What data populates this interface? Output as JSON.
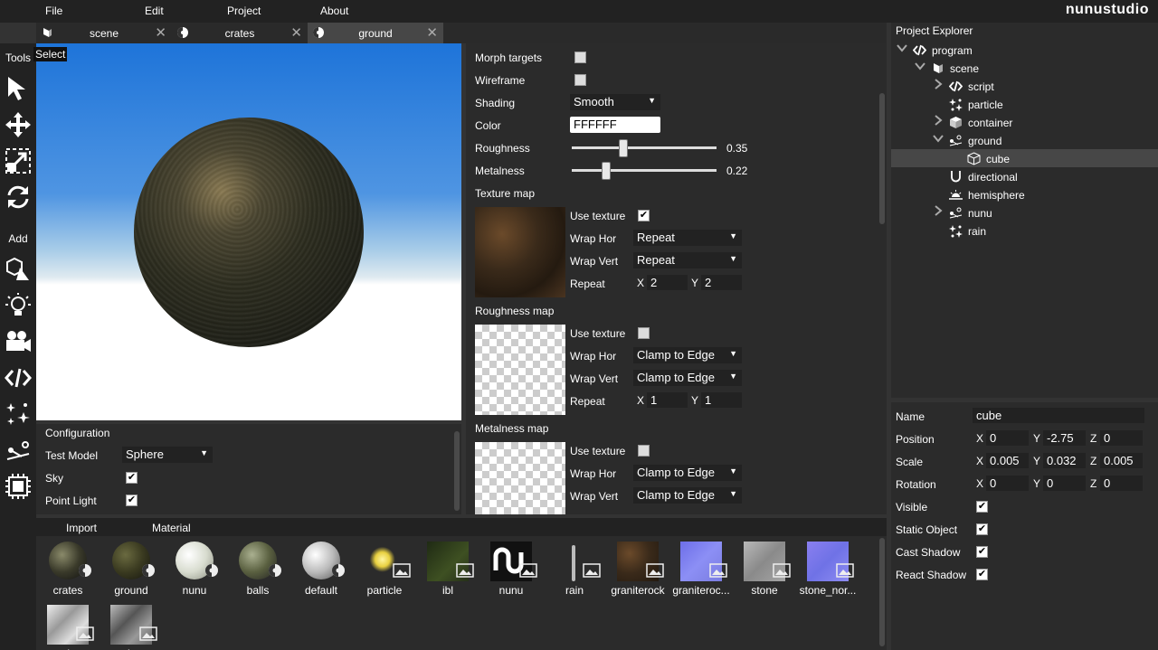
{
  "menu": {
    "file": "File",
    "edit": "Edit",
    "project": "Project",
    "about": "About"
  },
  "logo": "nunustudio",
  "tabs": [
    {
      "label": "scene",
      "icon": "scene-icon"
    },
    {
      "label": "crates",
      "icon": "material-icon"
    },
    {
      "label": "ground",
      "icon": "material-icon",
      "active": true
    }
  ],
  "toolbar": {
    "tools_heading": "Tools",
    "add_heading": "Add",
    "select_tooltip": "Select"
  },
  "config": {
    "title": "Configuration",
    "test_model_label": "Test Model",
    "test_model_value": "Sphere",
    "sky_label": "Sky",
    "sky_checked": true,
    "point_light_label": "Point Light",
    "point_light_checked": true
  },
  "material": {
    "morph_targets_label": "Morph targets",
    "wireframe_label": "Wireframe",
    "shading_label": "Shading",
    "shading_value": "Smooth",
    "color_label": "Color",
    "color_value": "FFFFFF",
    "roughness_label": "Roughness",
    "roughness_value": "0.35",
    "metalness_label": "Metalness",
    "metalness_value": "0.22",
    "texture_map": {
      "title": "Texture map",
      "use_texture_label": "Use texture",
      "use_texture": true,
      "wrap_hor_label": "Wrap Hor",
      "wrap_hor": "Repeat",
      "wrap_vert_label": "Wrap Vert",
      "wrap_vert": "Repeat",
      "repeat_label": "Repeat",
      "x_label": "X",
      "x": "2",
      "y_label": "Y",
      "y": "2"
    },
    "roughness_map": {
      "title": "Roughness map",
      "use_texture_label": "Use texture",
      "use_texture": false,
      "wrap_hor_label": "Wrap Hor",
      "wrap_hor": "Clamp to Edge",
      "wrap_vert_label": "Wrap Vert",
      "wrap_vert": "Clamp to Edge",
      "repeat_label": "Repeat",
      "x_label": "X",
      "x": "1",
      "y_label": "Y",
      "y": "1"
    },
    "metalness_map": {
      "title": "Metalness map",
      "use_texture_label": "Use texture",
      "use_texture": false,
      "wrap_hor_label": "Wrap Hor",
      "wrap_hor": "Clamp to Edge",
      "wrap_vert_label": "Wrap Vert",
      "wrap_vert": "Clamp to Edge"
    }
  },
  "explorer": {
    "title": "Project Explorer",
    "items": [
      {
        "label": "program",
        "icon": "code-icon"
      },
      {
        "label": "scene",
        "icon": "scene-icon"
      },
      {
        "label": "script",
        "icon": "code-icon"
      },
      {
        "label": "particle",
        "icon": "particles-icon"
      },
      {
        "label": "container",
        "icon": "cube-icon"
      },
      {
        "label": "ground",
        "icon": "spine-icon"
      },
      {
        "label": "cube",
        "icon": "cube-outline-icon"
      },
      {
        "label": "directional",
        "icon": "magnet-light-icon"
      },
      {
        "label": "hemisphere",
        "icon": "hemisphere-light-icon"
      },
      {
        "label": "nunu",
        "icon": "spine-icon"
      },
      {
        "label": "rain",
        "icon": "particles-icon"
      }
    ]
  },
  "inspector": {
    "name_label": "Name",
    "name_value": "cube",
    "position_label": "Position",
    "position": {
      "x": "0",
      "y": "-2.75",
      "z": "0"
    },
    "scale_label": "Scale",
    "scale": {
      "x": "0.005",
      "y": "0.032",
      "z": "0.005"
    },
    "rotation_label": "Rotation",
    "rotation": {
      "x": "0",
      "y": "0",
      "z": "0"
    },
    "axis": {
      "x": "X",
      "y": "Y",
      "z": "Z"
    },
    "visible_label": "Visible",
    "visible": true,
    "static_label": "Static Object",
    "static": true,
    "cast_shadow_label": "Cast Shadow",
    "cast_shadow": true,
    "react_shadow_label": "React Shadow",
    "react_shadow": true
  },
  "asset_tabs": {
    "import": "Import",
    "material": "Material"
  },
  "assets": [
    {
      "label": "crates",
      "kind": "material"
    },
    {
      "label": "ground",
      "kind": "material"
    },
    {
      "label": "nunu",
      "kind": "material"
    },
    {
      "label": "balls",
      "kind": "material"
    },
    {
      "label": "default",
      "kind": "material"
    },
    {
      "label": "particle",
      "kind": "texture"
    },
    {
      "label": "ibl",
      "kind": "texture"
    },
    {
      "label": "nunu",
      "kind": "texture"
    },
    {
      "label": "rain",
      "kind": "texture"
    },
    {
      "label": "graniterock",
      "kind": "texture"
    },
    {
      "label": "graniteroc...",
      "kind": "texture"
    },
    {
      "label": "stone",
      "kind": "texture"
    },
    {
      "label": "stone_nor...",
      "kind": "texture"
    },
    {
      "label": "metalness",
      "kind": "texture"
    },
    {
      "label": "roughness",
      "kind": "texture"
    }
  ]
}
